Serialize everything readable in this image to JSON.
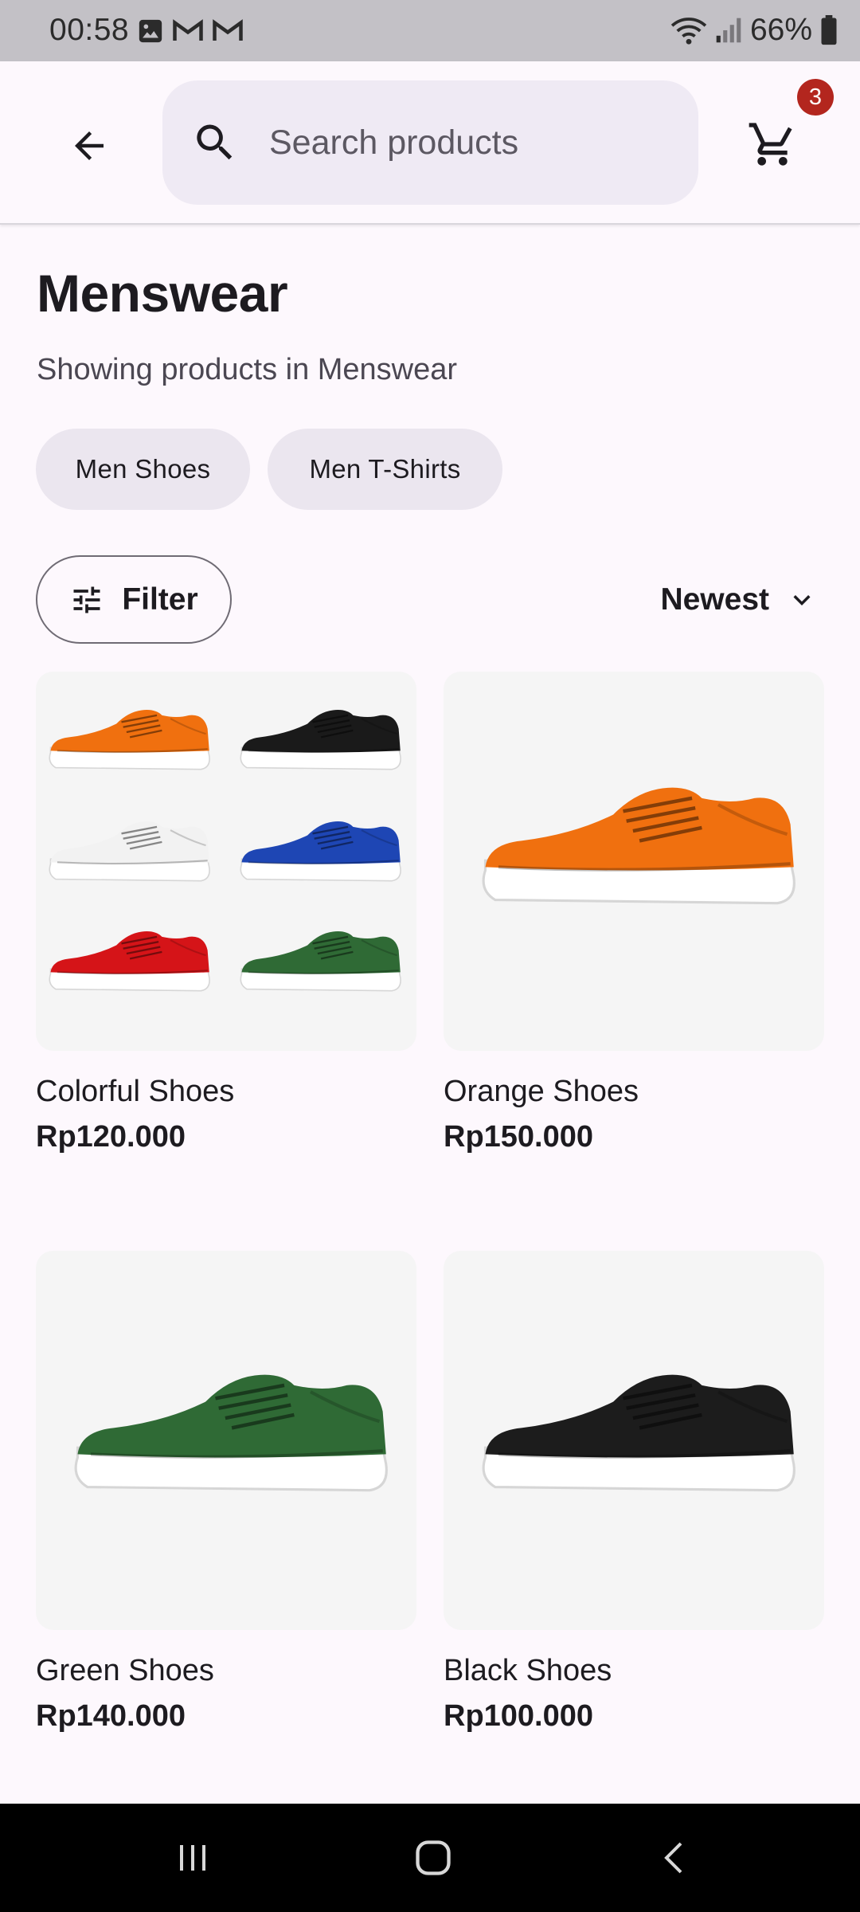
{
  "status_bar": {
    "time": "00:58",
    "battery": "66%",
    "icons_left": [
      "gallery-icon",
      "gmail-icon",
      "gmail-icon"
    ],
    "icons_right": [
      "wifi-icon",
      "signal-icon",
      "battery-icon"
    ]
  },
  "app_bar": {
    "search_placeholder": "Search products",
    "cart_count": "3"
  },
  "page": {
    "title": "Menswear",
    "subtitle": "Showing products in Menswear"
  },
  "chips": [
    {
      "label": "Men Shoes"
    },
    {
      "label": "Men T-Shirts"
    }
  ],
  "toolbar": {
    "filter_label": "Filter",
    "sort_label": "Newest"
  },
  "products": [
    {
      "name": "Colorful Shoes",
      "price": "Rp120.000",
      "colors": [
        "#f0700f",
        "#1a1a1a",
        "#f2f2f2",
        "#1e46b4",
        "#d51418",
        "#2f6a35"
      ]
    },
    {
      "name": "Orange Shoes",
      "price": "Rp150.000",
      "colors": [
        "#f0700f"
      ]
    },
    {
      "name": "Green Shoes",
      "price": "Rp140.000",
      "colors": [
        "#2f6a35"
      ]
    },
    {
      "name": "Black Shoes",
      "price": "Rp100.000",
      "colors": [
        "#1c1c1c"
      ]
    }
  ],
  "colors": {
    "background": "#fdf8fd",
    "search_bg": "#efeaf4",
    "chip_bg": "#ebe6ef",
    "badge": "#b3261e"
  }
}
